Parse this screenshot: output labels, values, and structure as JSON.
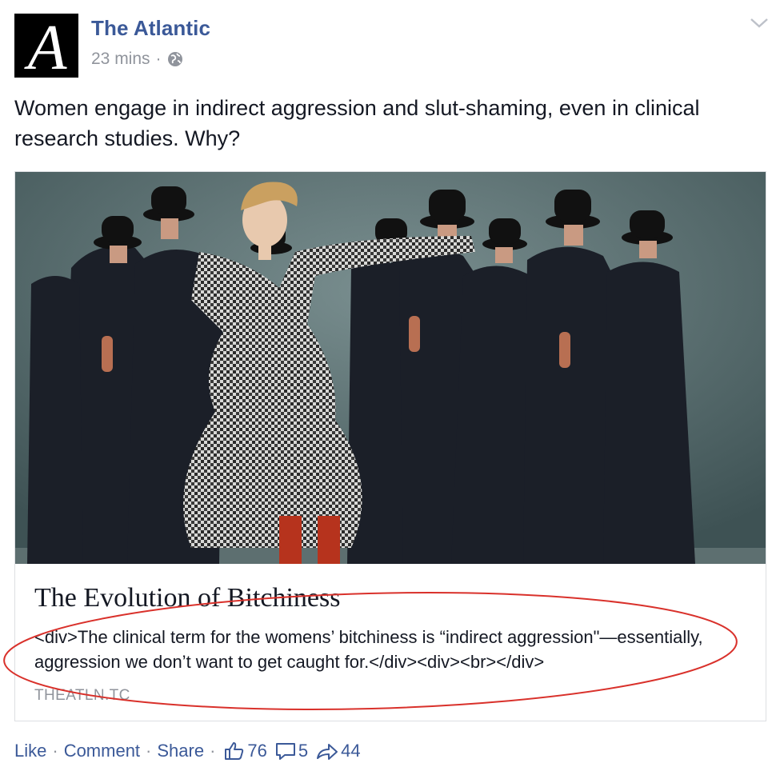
{
  "post": {
    "page_name": "The Atlantic",
    "avatar_letter": "A",
    "timestamp": "23 mins",
    "separator": "·",
    "audience_icon": "globe-icon",
    "status_text": "Women engage in indirect aggression and slut-shaming, even in clinical research studies. Why?"
  },
  "link_card": {
    "image": "photo of a woman in a houndstooth suit surrounded by men in black suits and bowler hats",
    "title": "The Evolution of Bitchiness",
    "description": "<div>The clinical term for the womens’ bitchiness is “indirect aggression\"—essentially, aggression we don’t want to get caught for.</div><div><br></div>",
    "domain": "THEATLN.TC",
    "annotation_color": "#d9312b"
  },
  "actions": {
    "like": "Like",
    "comment": "Comment",
    "share": "Share",
    "separator": "·",
    "likes_count": "76",
    "comments_count": "5",
    "shares_count": "44"
  },
  "colors": {
    "link_blue": "#3b5998",
    "meta_gray": "#90949c",
    "text": "#141823"
  }
}
